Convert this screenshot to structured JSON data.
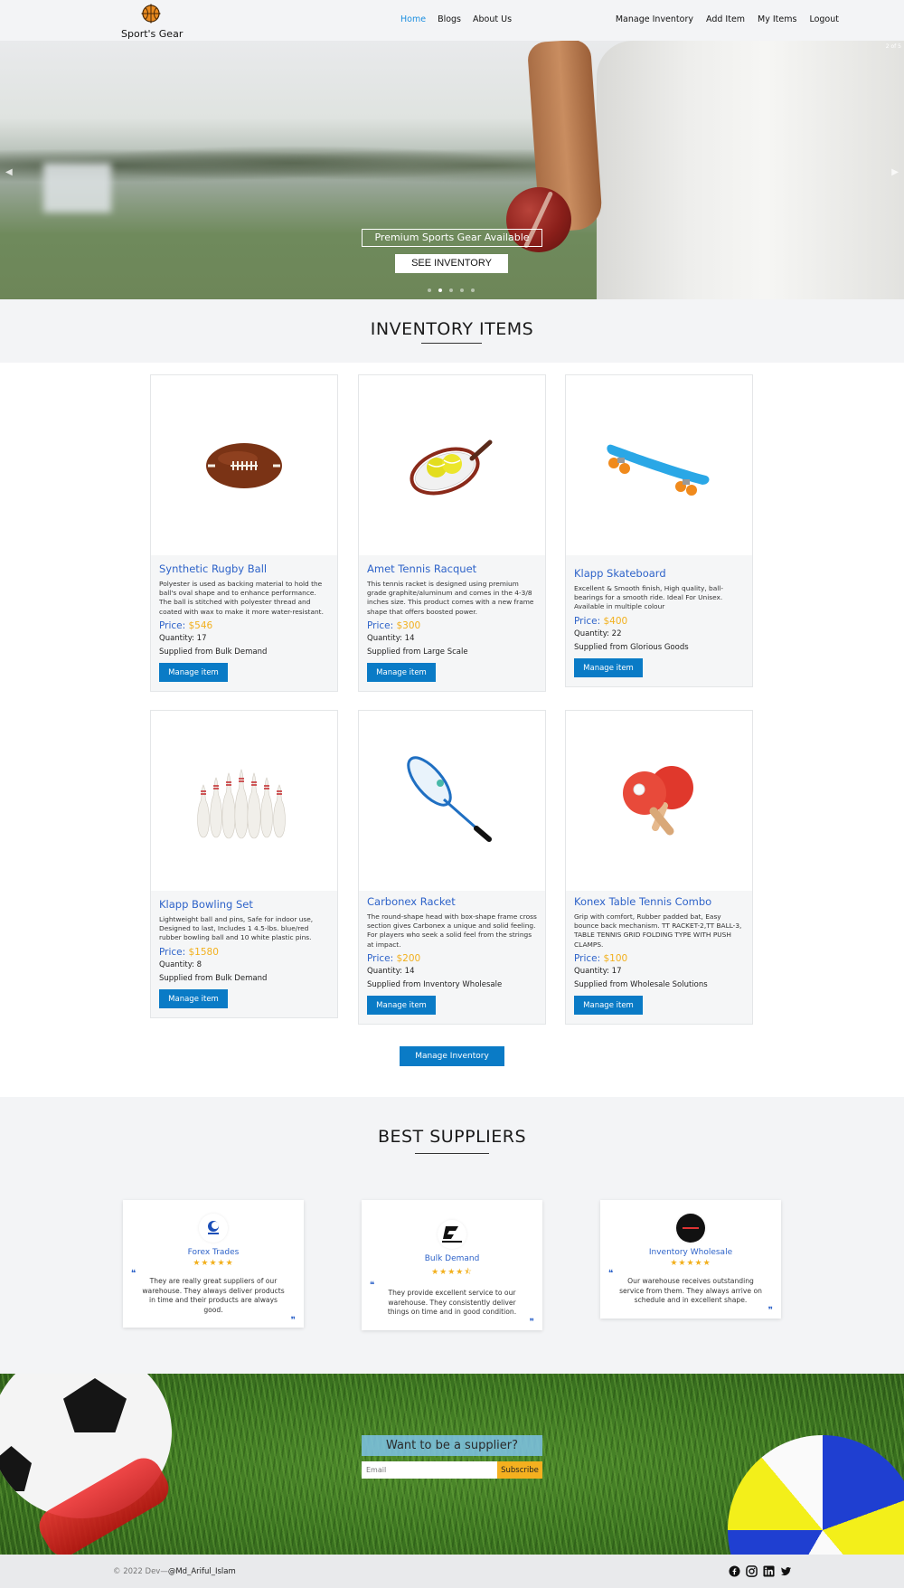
{
  "brand": {
    "name": "Sport's Gear"
  },
  "nav": {
    "center": [
      "Home",
      "Blogs",
      "About Us"
    ],
    "right": [
      "Manage Inventory",
      "Add Item",
      "My Items",
      "Logout"
    ]
  },
  "hero": {
    "caption": "Premium Sports Gear Available",
    "button": "SEE INVENTORY",
    "counter": "2 of 5",
    "slides_total": 5,
    "active_slide": 2
  },
  "inventory": {
    "title": "INVENTORY ITEMS",
    "price_label": "Price:",
    "manage_label": "Manage item",
    "items": [
      {
        "name": "Synthetic Rugby Ball",
        "desc": "Polyester is used as backing material to hold the ball's oval shape and to enhance performance. The ball is stitched with polyester thread and coated with wax to make it more water-resistant.",
        "price": "$546",
        "qty": "Quantity: 17",
        "supplier": "Supplied from Bulk Demand",
        "icon": "rugby-ball-icon"
      },
      {
        "name": "Amet Tennis Racquet",
        "desc": "This tennis racket is designed using premium grade graphite/aluminum and comes in the 4-3/8 inches size. This product comes with a new frame shape that offers boosted power.",
        "price": "$300",
        "qty": "Quantity: 14",
        "supplier": "Supplied from Large Scale",
        "icon": "tennis-racquet-icon"
      },
      {
        "name": "Klapp Skateboard",
        "desc": "Excellent & Smooth finish, High quality, ball-bearings for a smooth ride. Ideal For Unisex. Available in multiple colour",
        "price": "$400",
        "qty": "Quantity: 22",
        "supplier": "Supplied from Glorious Goods",
        "icon": "skateboard-icon"
      },
      {
        "name": "Klapp Bowling Set",
        "desc": "Lightweight ball and pins, Safe for indoor use, Designed to last, Includes 1 4.5-lbs. blue/red rubber bowling ball and 10 white plastic pins.",
        "price": "$1580",
        "qty": "Quantity: 8",
        "supplier": "Supplied from Bulk Demand",
        "icon": "bowling-pins-icon"
      },
      {
        "name": "Carbonex Racket",
        "desc": "The round-shape head with box-shape frame cross section gives Carbonex a unique and solid feeling. For players who seek a solid feel from the strings at impact.",
        "price": "$200",
        "qty": "Quantity: 14",
        "supplier": "Supplied from Inventory Wholesale",
        "icon": "badminton-racket-icon"
      },
      {
        "name": "Konex Table Tennis Combo",
        "desc": "Grip with comfort, Rubber padded bat, Easy bounce back mechanism. TT RACKET-2,TT BALL-3, TABLE TENNIS GRID FOLDING TYPE WITH PUSH CLAMPS.",
        "price": "$100",
        "qty": "Quantity: 17",
        "supplier": "Supplied from Wholesale Solutions",
        "icon": "table-tennis-icon"
      }
    ],
    "manage_all": "Manage Inventory"
  },
  "suppliers": {
    "title": "BEST SUPPLIERS",
    "stars": "★★★★★",
    "list": [
      {
        "name": "Forex Trades",
        "rating": 5,
        "quote": "They are really great suppliers of our warehouse. They always deliver products in time and their products are always good.",
        "icon": "forex-logo-icon"
      },
      {
        "name": "Bulk Demand",
        "rating": 4.5,
        "stars": "★★★★⯪",
        "quote": "They provide excellent service to our warehouse. They consistently deliver things on time and in good condition.",
        "icon": "champro-logo-icon"
      },
      {
        "name": "Inventory Wholesale",
        "rating": 5,
        "quote": "Our warehouse receives outstanding service from them. They always arrive on schedule and in excellent shape.",
        "icon": "wholesale-logo-icon"
      }
    ]
  },
  "subscribe": {
    "title": "Want to be a supplier?",
    "placeholder": "Email",
    "button": "Subscribe"
  },
  "footer": {
    "copyright": "© 2022 Dev—",
    "handle": "@Md_Ariful_Islam",
    "socials": [
      "facebook-icon",
      "instagram-icon",
      "linkedin-icon",
      "twitter-icon"
    ]
  },
  "colors": {
    "accent": "#0a7bc6",
    "link": "#2e63c9",
    "price": "#f2b01e",
    "nav_active": "#1d8fe0"
  }
}
